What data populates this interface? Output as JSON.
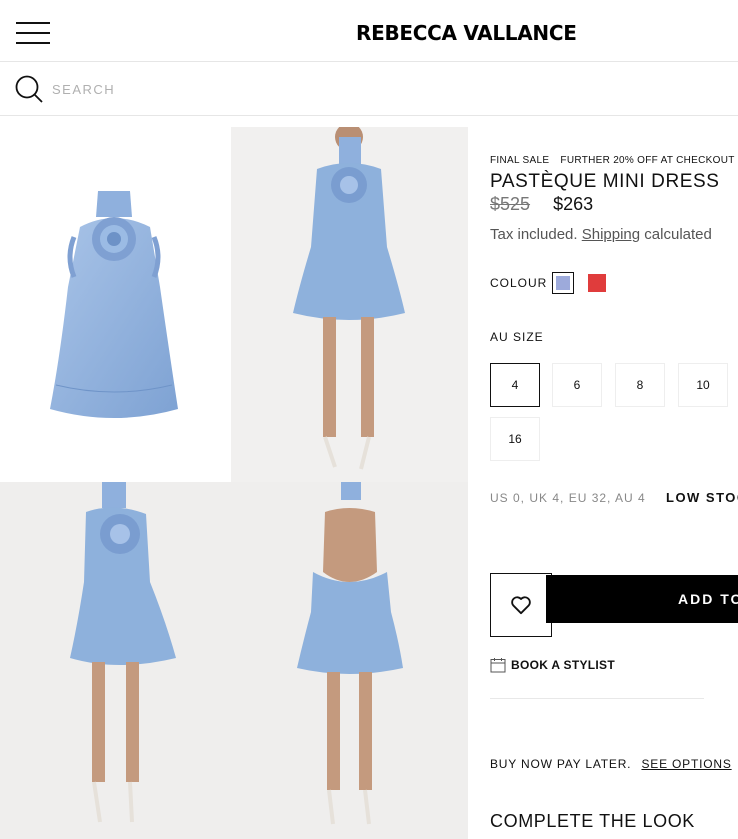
{
  "header": {
    "logo": "REBECCA VALLANCE"
  },
  "search": {
    "placeholder": "SEARCH"
  },
  "product": {
    "tags": [
      "FINAL SALE",
      "FURTHER 20% OFF AT CHECKOUT"
    ],
    "title": "PASTÈQUE MINI DRESS",
    "price_original": "$525",
    "price_sale": "$263",
    "tax_text": "Tax included.",
    "shipping_link": "Shipping",
    "tax_suffix": "calculated",
    "colour_label": "COLOUR",
    "colours": [
      {
        "name": "blue",
        "hex": "#9daadb",
        "selected": true
      },
      {
        "name": "red",
        "hex": "#e03c3c",
        "selected": false
      }
    ],
    "size_label": "AU SIZE",
    "sizes": [
      "4",
      "6",
      "8",
      "10",
      "16"
    ],
    "selected_size": "4",
    "size_conversion": "US 0, UK 4, EU 32, AU 4",
    "stock_status": "LOW STOCK",
    "add_to_bag": "ADD TO BAG",
    "book_stylist": "BOOK A STYLIST",
    "bnpl_text": "BUY NOW PAY LATER.",
    "bnpl_link": "SEE OPTIONS",
    "complete_look": "COMPLETE THE LOOK"
  },
  "gallery": {
    "images": [
      "dress-flat-lay",
      "model-front",
      "model-three-quarter",
      "model-back"
    ],
    "dress_color": "#8eb1dc"
  }
}
